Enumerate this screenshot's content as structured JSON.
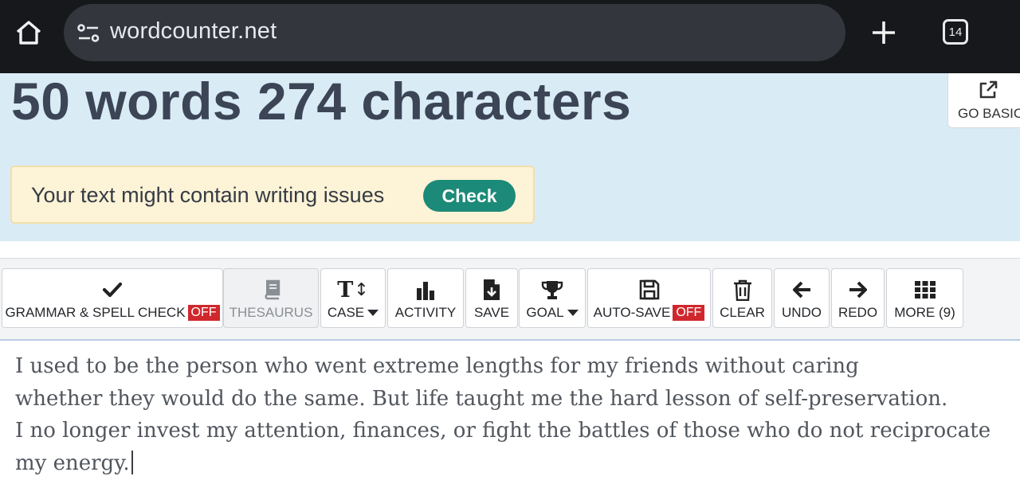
{
  "browser": {
    "url": "wordcounter.net",
    "tab_count": "14",
    "icons": [
      "home-icon",
      "site-settings-icon",
      "plus-icon",
      "tab-switcher-icon"
    ]
  },
  "header": {
    "count_title": "50 words 274 characters",
    "go_basic_label": "GO BASIC",
    "issues_text": "Your text might contain writing issues",
    "check_label": "Check"
  },
  "toolbar": {
    "grammar": {
      "label": "GRAMMAR & SPELL CHECK",
      "status": "OFF",
      "icon": "checkmark-icon"
    },
    "thesaurus": {
      "label": "THESAURUS",
      "icon": "book-icon"
    },
    "case": {
      "label": "CASE",
      "icon": "text-case-icon"
    },
    "activity": {
      "label": "ACTIVITY",
      "icon": "bar-chart-icon"
    },
    "save": {
      "label": "SAVE",
      "icon": "save-file-icon"
    },
    "goal": {
      "label": "GOAL",
      "icon": "trophy-icon"
    },
    "autosave": {
      "label": "AUTO-SAVE",
      "status": "OFF",
      "icon": "floppy-disk-icon"
    },
    "clear": {
      "label": "CLEAR",
      "icon": "trash-icon"
    },
    "undo": {
      "label": "UNDO",
      "icon": "arrow-left-icon"
    },
    "redo": {
      "label": "REDO",
      "icon": "arrow-right-icon"
    },
    "more": {
      "label": "MORE (9)",
      "icon": "grid-icon"
    }
  },
  "editor": {
    "lines": [
      "I used to be the person who went extreme lengths for my friends without caring",
      "whether they would do the same. But life taught me the hard lesson of self-preservation.",
      "I no longer invest my attention, finances, or fight the battles of those who do not reciprocate",
      "my energy."
    ]
  },
  "colors": {
    "browser_bar": "#16181b",
    "header_bg": "#d9ecf6",
    "title_text": "#3c4556",
    "check_button": "#1c8a78",
    "off_badge": "#d0272c",
    "issues_bg": "#fdf3d6"
  }
}
